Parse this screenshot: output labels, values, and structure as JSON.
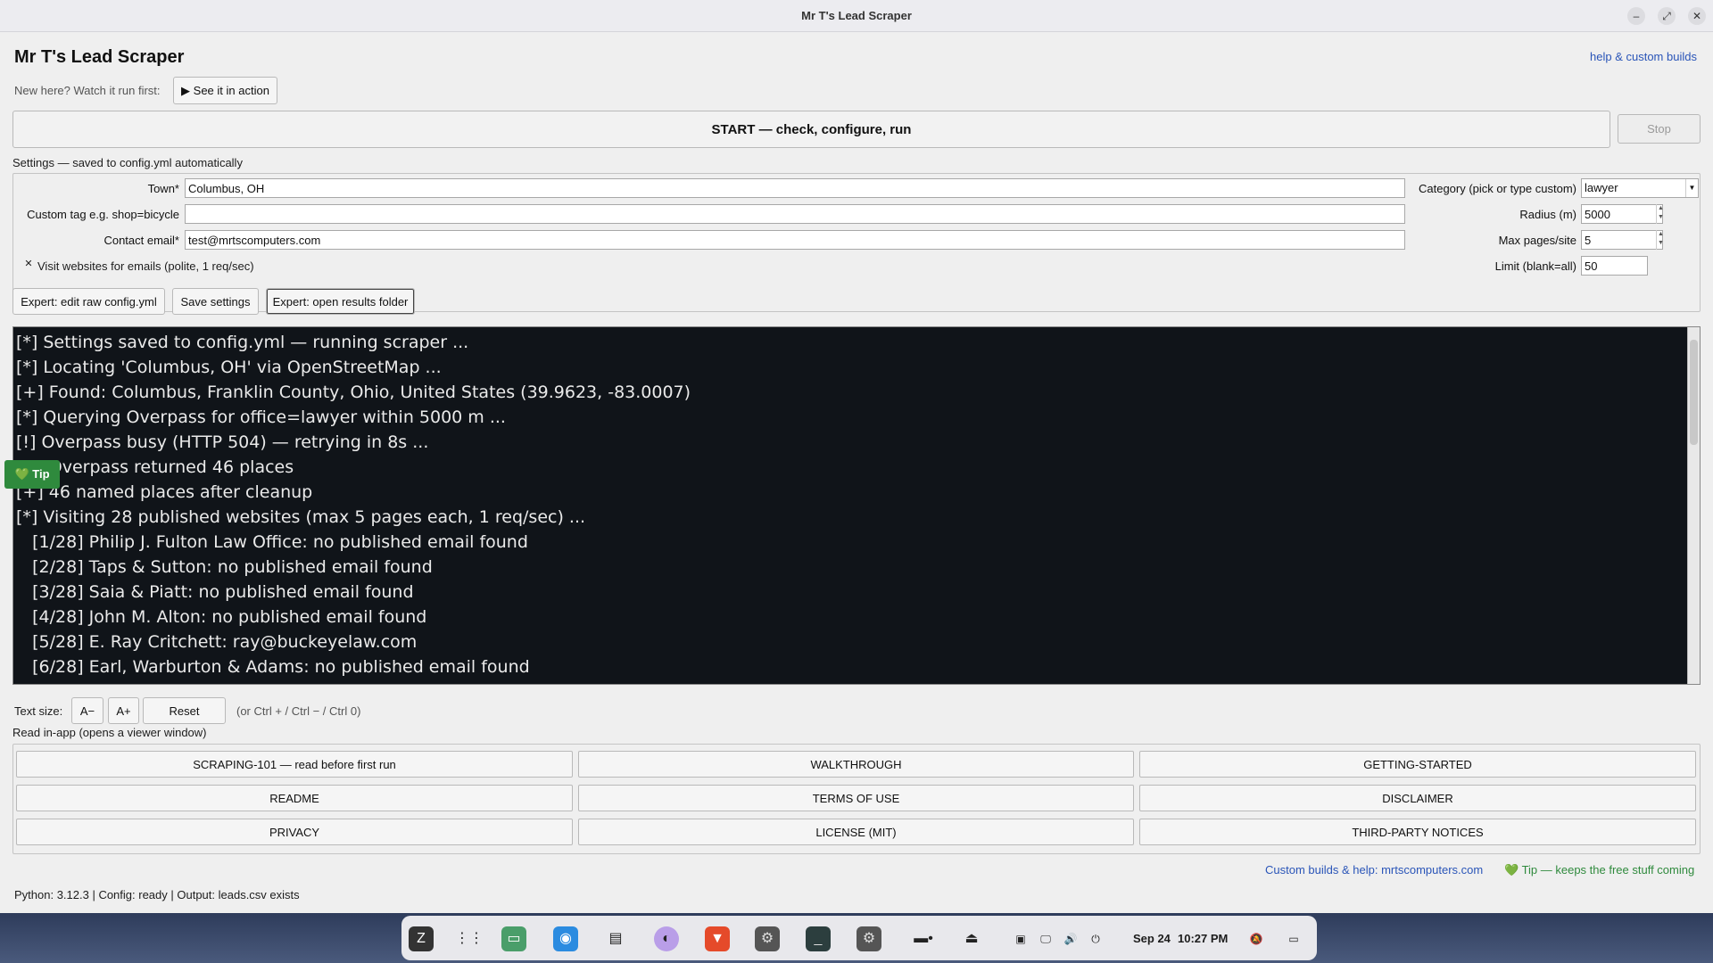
{
  "window": {
    "title": "Mr T's Lead Scraper"
  },
  "header": {
    "app_title": "Mr T's Lead Scraper",
    "help_link": "help & custom builds",
    "new_here_label": "New here? Watch it run first:",
    "see_it_label": "▶ See it in action"
  },
  "run": {
    "start_label": "START — check, configure, run",
    "stop_label": "Stop"
  },
  "settings": {
    "caption": "Settings — saved to config.yml automatically",
    "town_label": "Town*",
    "town_value": "Columbus, OH",
    "custom_tag_label": "Custom tag e.g. shop=bicycle",
    "custom_tag_value": "",
    "email_label": "Contact email*",
    "email_value": "test@mrtscomputers.com",
    "visit_label": "Visit websites for emails (polite, 1 req/sec)",
    "visit_checked": true,
    "category_label": "Category (pick or type custom)",
    "category_value": "lawyer",
    "radius_label": "Radius (m)",
    "radius_value": "5000",
    "max_pages_label": "Max pages/site",
    "max_pages_value": "5",
    "limit_label": "Limit (blank=all)",
    "limit_value": "50"
  },
  "actions": {
    "edit_config": "Expert: edit raw config.yml",
    "save": "Save settings",
    "open_results": "Expert: open results folder"
  },
  "log": {
    "lines": [
      "[*] Settings saved to config.yml — running scraper ...",
      "[*] Locating 'Columbus, OH' via OpenStreetMap ...",
      "[+] Found: Columbus, Franklin County, Ohio, United States (39.9623, -83.0007)",
      "[*] Querying Overpass for office=lawyer within 5000 m ...",
      "[!] Overpass busy (HTTP 504) — retrying in 8s ...",
      "[+] Overpass returned 46 places",
      "[+] 46 named places after cleanup",
      "[*] Visiting 28 published websites (max 5 pages each, 1 req/sec) ...",
      "   [1/28] Philip J. Fulton Law Office: no published email found",
      "   [2/28] Taps & Sutton: no published email found",
      "   [3/28] Saia & Piatt: no published email found",
      "   [4/28] John M. Alton: no published email found",
      "   [5/28] E. Ray Critchett: ray@buckeyelaw.com",
      "   [6/28] Earl, Warburton & Adams: no published email found"
    ],
    "tip_label": "💚 Tip"
  },
  "textsize": {
    "label": "Text size:",
    "smaller": "A−",
    "larger": "A+",
    "reset": "Reset",
    "hint": "(or Ctrl + / Ctrl − / Ctrl 0)"
  },
  "docs": {
    "caption": "Read in-app (opens a viewer window)",
    "buttons": [
      "SCRAPING-101 — read before first run",
      "WALKTHROUGH",
      "GETTING-STARTED",
      "README",
      "TERMS OF USE",
      "DISCLAIMER",
      "PRIVACY",
      "LICENSE (MIT)",
      "THIRD-PARTY NOTICES"
    ]
  },
  "footer": {
    "custom_builds": "Custom builds & help: mrtscomputers.com",
    "tip": "💚 Tip — keeps the free stuff coming",
    "status": "Python: 3.12.3 | Config: ready | Output: leads.csv exists"
  },
  "taskbar": {
    "date": "Sep 24",
    "time": "10:27 PM"
  }
}
